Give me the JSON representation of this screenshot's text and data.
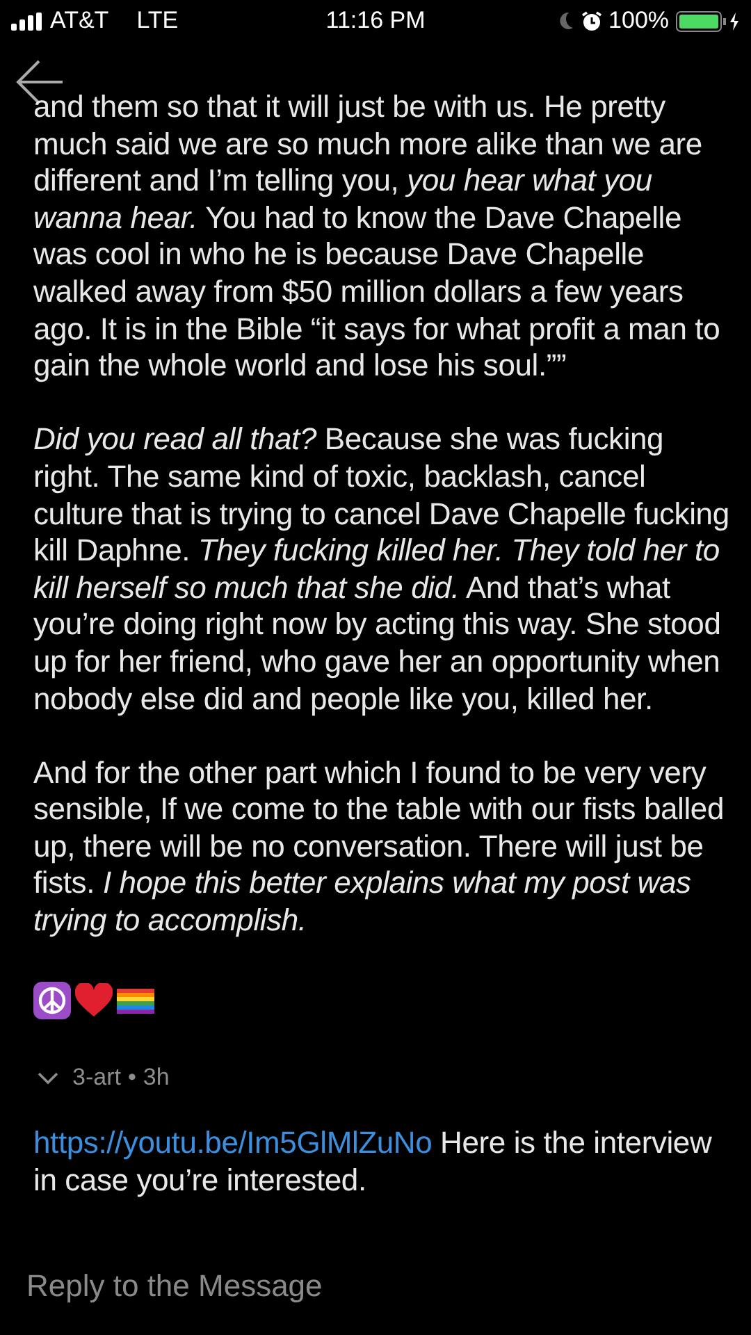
{
  "status_bar": {
    "carrier": "AT&T",
    "network": "LTE",
    "time": "11:16 PM",
    "battery": "100%"
  },
  "message": {
    "cut_line": "and them so that it will just be with us. He pretty",
    "paragraphs": [
      "much said we are so much more alike than we are different and I’m telling you, *you hear what you wanna hear.* You had to know the Dave Chapelle was cool in who he is because Dave Chapelle walked away from $50 million dollars a few years ago. It is in the Bible “it says for what profit a man to gain the whole world and lose his soul.””",
      "*Did you read all that?* Because she was fucking right. The same kind of toxic, backlash, cancel culture that is trying to cancel Dave Chapelle fucking kill Daphne. *They fucking killed her. They told her to kill herself so much that she did.* And that’s what you’re doing right now by acting this way. She stood up for her friend, who gave her an opportunity when nobody else did and people like you, killed her.",
      "And for the other part which I found to be very very sensible, If we come to the table with our fists balled up, there will be no conversation. There will just be fists. *I hope this better explains what my post was trying to accomplish.*"
    ]
  },
  "comment": {
    "author": "3-art",
    "separator": "•",
    "time": "3h",
    "link": "https://youtu.be/Im5GlMlZuNo",
    "text": " Here is the interview in case you’re interested."
  },
  "reply": {
    "placeholder": "Reply to the Message"
  }
}
